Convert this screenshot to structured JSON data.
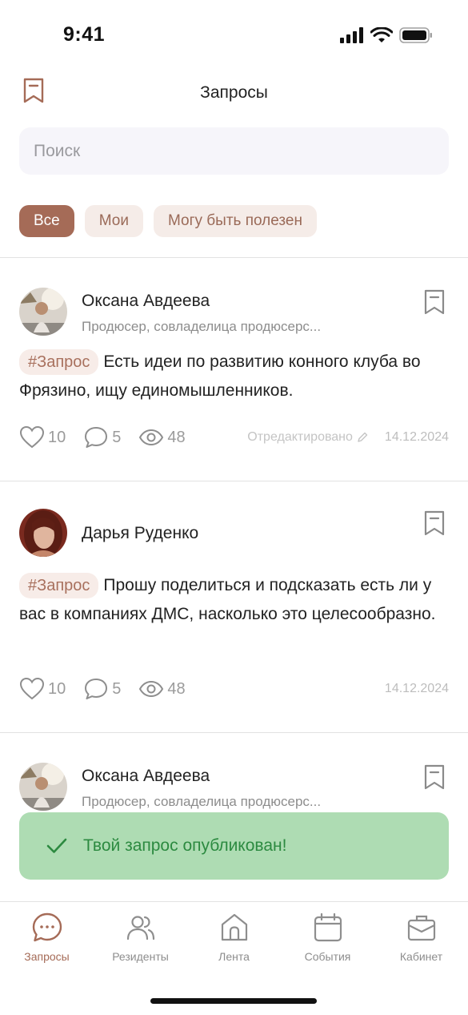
{
  "status_bar": {
    "time": "9:41"
  },
  "header": {
    "title": "Запросы"
  },
  "search": {
    "placeholder": "Поиск"
  },
  "filters": [
    {
      "label": "Все",
      "active": true
    },
    {
      "label": "Мои",
      "active": false
    },
    {
      "label": "Могу быть полезен",
      "active": false
    }
  ],
  "posts": [
    {
      "author": "Оксана Авдеева",
      "role": "Продюсер, совладелица продюсерс...",
      "tag": "#Запрос",
      "text": "Есть идеи по развитию конного клуба во Фрязино, ищу единомышленников.",
      "likes": "10",
      "comments": "5",
      "views": "48",
      "edited": "Отредактировано",
      "date": "14.12.2024"
    },
    {
      "author": "Дарья Руденко",
      "tag": "#Запрос",
      "text": "Прошу поделиться и подсказать есть ли у вас в компаниях ДМС, насколько это целесообразно.",
      "likes": "10",
      "comments": "5",
      "views": "48",
      "date": "14.12.2024"
    },
    {
      "author": "Оксана Авдеева",
      "role": "Продюсер, совладелица продюсерс..."
    }
  ],
  "toast": {
    "message": "Твой запрос опубликован!",
    "color": "#aedcb3"
  },
  "tabbar": [
    {
      "label": "Запросы",
      "icon": "chat-icon",
      "active": true
    },
    {
      "label": "Резиденты",
      "icon": "users-icon",
      "active": false
    },
    {
      "label": "Лента",
      "icon": "home-icon",
      "active": false
    },
    {
      "label": "События",
      "icon": "calendar-icon",
      "active": false
    },
    {
      "label": "Кабинет",
      "icon": "briefcase-icon",
      "active": false
    }
  ],
  "colors": {
    "accent": "#a56b57",
    "chip_bg": "#f5ece8",
    "toast_text": "#2c8a40"
  }
}
